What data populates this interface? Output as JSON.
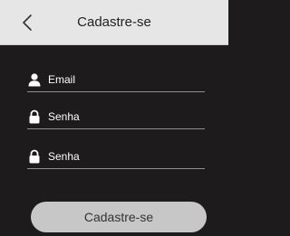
{
  "header": {
    "title": "Cadastre-se",
    "back_icon": "chevron-left-icon"
  },
  "form": {
    "email": {
      "label": "Email",
      "icon": "user-icon"
    },
    "password": {
      "label": "Senha",
      "icon": "lock-icon"
    },
    "confirm_password": {
      "label": "Senha",
      "icon": "lock-icon"
    },
    "submit_label": "Cadastre-se"
  },
  "colors": {
    "header_background": "#e6e6e6",
    "page_background": "#1d1b1c",
    "field_text": "#ffffff",
    "field_underline": "#8f8f8f",
    "button_background": "#c7c7c7",
    "button_text": "#333333"
  }
}
